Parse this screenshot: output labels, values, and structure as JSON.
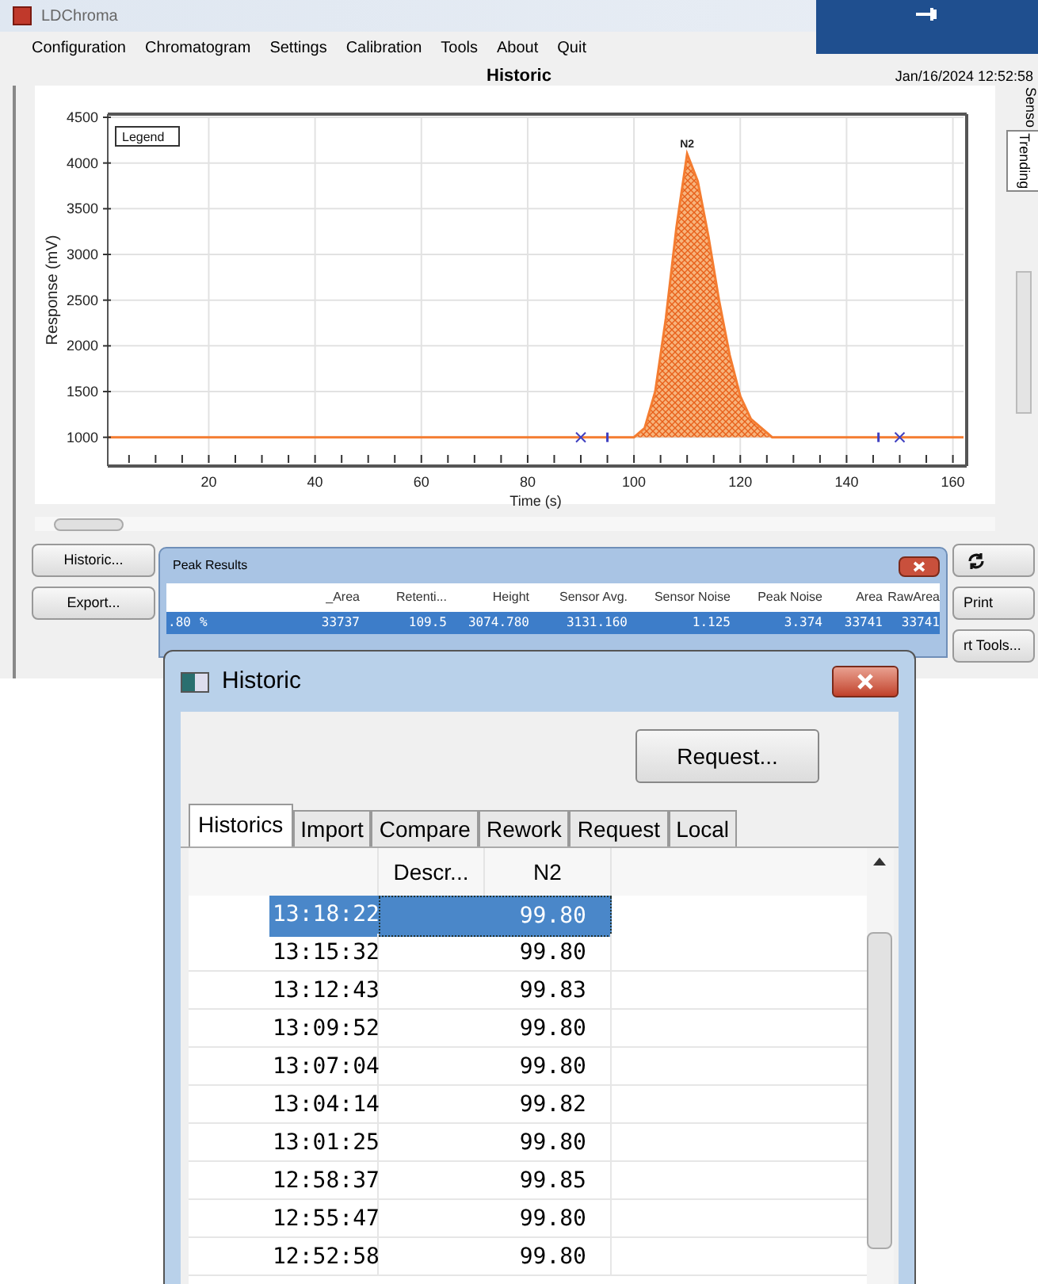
{
  "app": {
    "title": "LDChroma",
    "menu": [
      "Configuration",
      "Chromatogram",
      "Settings",
      "Calibration",
      "Tools",
      "About",
      "Quit"
    ],
    "view_title": "Historic",
    "datetime": "Jan/16/2024 12:52:58"
  },
  "side_tabs": [
    {
      "label": "Senso",
      "selected": false
    },
    {
      "label": "Trending",
      "selected": true
    }
  ],
  "chart": {
    "legend": "Legend",
    "chart_data": {
      "type": "area",
      "xlabel": "Time (s)",
      "ylabel": "Response (mV)",
      "x": [
        1,
        90,
        95,
        100,
        102,
        104,
        106,
        108,
        110,
        112,
        114,
        116,
        118,
        120,
        122,
        124,
        126,
        130,
        135,
        146,
        150,
        162
      ],
      "series": [
        {
          "name": "N2",
          "color": "#f47c30",
          "values": [
            1000,
            1000,
            1000,
            1000,
            1100,
            1500,
            2300,
            3300,
            4100,
            3800,
            3200,
            2500,
            1900,
            1450,
            1200,
            1100,
            1000,
            1000,
            1000,
            1000,
            1000,
            1000
          ]
        }
      ],
      "xlim": [
        1,
        162
      ],
      "ylim": [
        720,
        4500
      ],
      "xticks": [
        20,
        40,
        60,
        80,
        100,
        120,
        140,
        160
      ],
      "yticks": [
        1000,
        1500,
        2000,
        2500,
        3000,
        3500,
        4000,
        4500
      ],
      "grid": true
    }
  },
  "left_buttons": [
    "Historic...",
    "Export..."
  ],
  "right_buttons": [
    "Print",
    "rt Tools..."
  ],
  "peak_results": {
    "title": "Peak Results",
    "columns": [
      "",
      "",
      "_Area",
      "Retenti...",
      "Height",
      "Sensor Avg.",
      "Sensor Noise",
      "Peak Noise",
      "Area",
      "RawArea"
    ],
    "rows": [
      {
        "selected": true,
        "cells": [
          ".80",
          "%",
          "33737",
          "109.5",
          "3074.780",
          "3131.160",
          "1.125",
          "3.374",
          "33741",
          "33741"
        ]
      }
    ]
  },
  "historic_dialog": {
    "title": "Historic",
    "request_button": "Request...",
    "tabs": [
      {
        "label": "Historics",
        "selected": true
      },
      {
        "label": "Import",
        "selected": false
      },
      {
        "label": "Compare",
        "selected": false
      },
      {
        "label": "Rework",
        "selected": false
      },
      {
        "label": "Request",
        "selected": false
      },
      {
        "label": "Local",
        "selected": false
      }
    ],
    "columns": [
      "",
      "Descr...",
      "N2"
    ],
    "rows": [
      {
        "time": "13:18:22",
        "value": "99.80",
        "selected": true
      },
      {
        "time": "13:15:32",
        "value": "99.80",
        "selected": false
      },
      {
        "time": "13:12:43",
        "value": "99.83",
        "selected": false
      },
      {
        "time": "13:09:52",
        "value": "99.80",
        "selected": false
      },
      {
        "time": "13:07:04",
        "value": "99.80",
        "selected": false
      },
      {
        "time": "13:04:14",
        "value": "99.82",
        "selected": false
      },
      {
        "time": "13:01:25",
        "value": "99.80",
        "selected": false
      },
      {
        "time": "12:58:37",
        "value": "99.85",
        "selected": false
      },
      {
        "time": "12:55:47",
        "value": "99.80",
        "selected": false
      },
      {
        "time": "12:52:58",
        "value": "99.80",
        "selected": false
      }
    ]
  }
}
